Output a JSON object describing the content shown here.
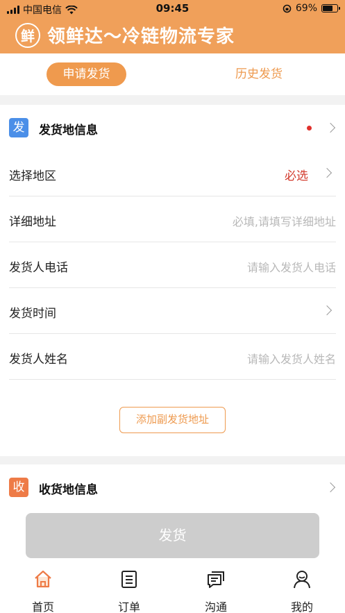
{
  "status_bar": {
    "carrier": "中国电信",
    "time": "09:45",
    "battery": "69%",
    "battery_level": 0.69
  },
  "header": {
    "logo_char": "鲜",
    "title": "领鲜达～冷链物流专家"
  },
  "tabs": [
    {
      "label": "申请发货",
      "active": true
    },
    {
      "label": "历史发货",
      "active": false
    }
  ],
  "sender": {
    "badge": "发",
    "title": "发货地信息",
    "rows": [
      {
        "label": "选择地区",
        "value": "必选"
      },
      {
        "label": "详细地址",
        "placeholder": "必填,请填写详细地址"
      },
      {
        "label": "发货人电话",
        "placeholder": "请输入发货人电话"
      },
      {
        "label": "发货时间",
        "value": ""
      },
      {
        "label": "发货人姓名",
        "placeholder": "请输入发货人姓名"
      }
    ],
    "add_button": "添加副发货地址"
  },
  "receiver": {
    "badge": "收",
    "title": "收货地信息"
  },
  "submit_label": "发货",
  "tabbar": [
    {
      "label": "首页",
      "icon": "home-icon",
      "active": true
    },
    {
      "label": "订单",
      "icon": "order-icon",
      "active": false
    },
    {
      "label": "沟通",
      "icon": "chat-icon",
      "active": false
    },
    {
      "label": "我的",
      "icon": "user-icon",
      "active": false
    }
  ],
  "colors": {
    "accent": "#f0a05a",
    "required": "#d23a2c",
    "sender_badge": "#4b8fe8",
    "receiver_badge": "#ee7b47"
  }
}
